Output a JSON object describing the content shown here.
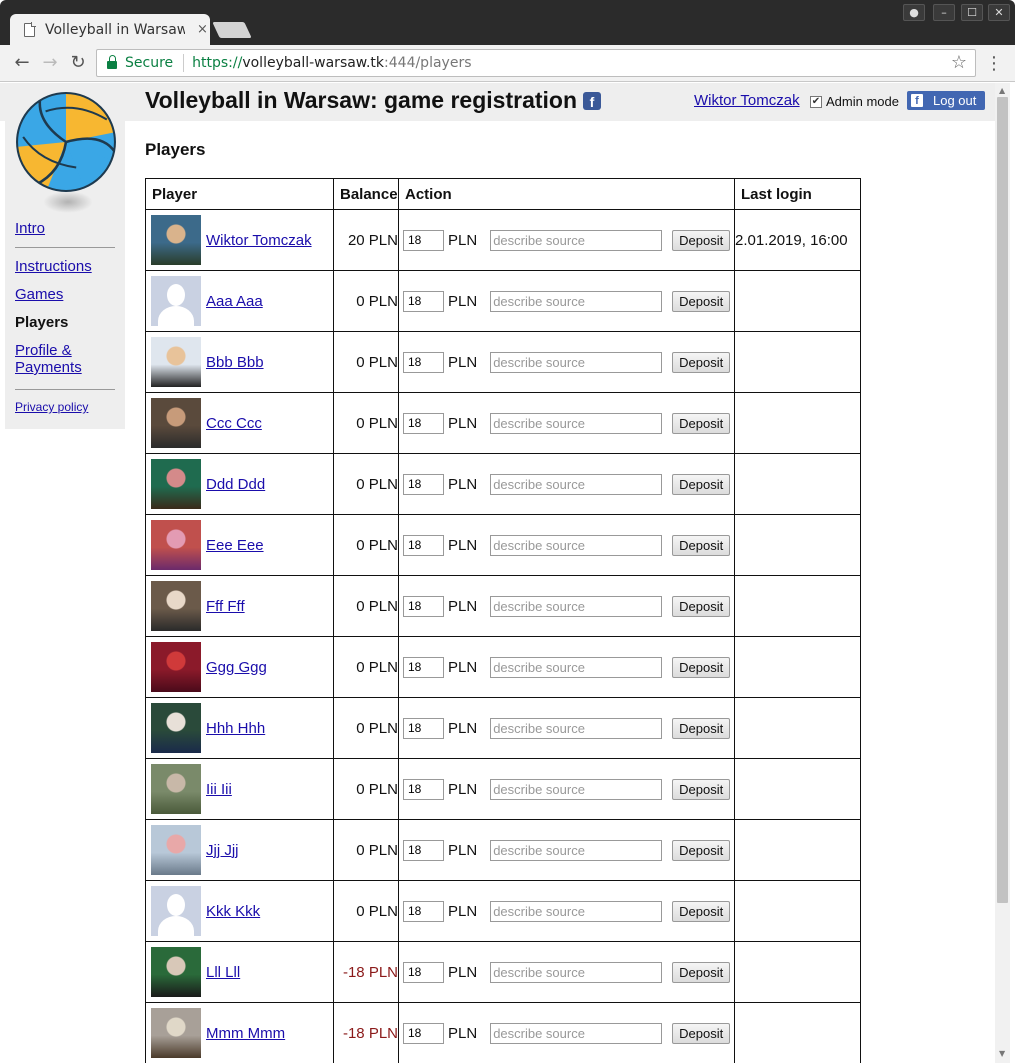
{
  "browser": {
    "tab_title": "Volleyball in Warsaw",
    "tab_close": "×",
    "secure_label": "Secure",
    "url_scheme": "https://",
    "url_host": "volleyball-warsaw.tk",
    "url_rest": ":444/players"
  },
  "header": {
    "title": "Volleyball in Warsaw: game registration",
    "facebook_glyph": "f",
    "user_name": "Wiktor Tomczak",
    "admin_checked": true,
    "admin_label": "Admin mode",
    "logout_label": "Log out"
  },
  "sidebar": {
    "items": [
      {
        "label": "Intro",
        "current": false
      },
      {
        "label": "Instructions",
        "current": false
      },
      {
        "label": "Games",
        "current": false
      },
      {
        "label": "Players",
        "current": true
      },
      {
        "label": "Profile & Payments",
        "current": false
      },
      {
        "label": "Privacy policy",
        "current": false
      }
    ]
  },
  "section_title": "Players",
  "table": {
    "headers": [
      "Player",
      "Balance",
      "Action",
      "Last login"
    ],
    "amount_default": "18",
    "currency": "PLN",
    "source_placeholder": "describe source",
    "deposit_label": "Deposit",
    "rows": [
      {
        "name": "Wiktor Tomczak",
        "balance": "20 PLN",
        "negative": false,
        "last_login": "2.01.2019, 16:00",
        "avatar": "photo"
      },
      {
        "name": "Aaa Aaa",
        "balance": "0 PLN",
        "negative": false,
        "last_login": "",
        "avatar": "default"
      },
      {
        "name": "Bbb Bbb",
        "balance": "0 PLN",
        "negative": false,
        "last_login": "",
        "avatar": "photo"
      },
      {
        "name": "Ccc Ccc",
        "balance": "0 PLN",
        "negative": false,
        "last_login": "",
        "avatar": "photo"
      },
      {
        "name": "Ddd Ddd",
        "balance": "0 PLN",
        "negative": false,
        "last_login": "",
        "avatar": "photo"
      },
      {
        "name": "Eee Eee",
        "balance": "0 PLN",
        "negative": false,
        "last_login": "",
        "avatar": "photo"
      },
      {
        "name": "Fff Fff",
        "balance": "0 PLN",
        "negative": false,
        "last_login": "",
        "avatar": "photo"
      },
      {
        "name": "Ggg Ggg",
        "balance": "0 PLN",
        "negative": false,
        "last_login": "",
        "avatar": "photo"
      },
      {
        "name": "Hhh Hhh",
        "balance": "0 PLN",
        "negative": false,
        "last_login": "",
        "avatar": "photo"
      },
      {
        "name": "Iii Iii",
        "balance": "0 PLN",
        "negative": false,
        "last_login": "",
        "avatar": "photo"
      },
      {
        "name": "Jjj Jjj",
        "balance": "0 PLN",
        "negative": false,
        "last_login": "",
        "avatar": "photo"
      },
      {
        "name": "Kkk Kkk",
        "balance": "0 PLN",
        "negative": false,
        "last_login": "",
        "avatar": "default"
      },
      {
        "name": "Lll Lll",
        "balance": "-18 PLN",
        "negative": true,
        "last_login": "",
        "avatar": "photo"
      },
      {
        "name": "Mmm Mmm",
        "balance": "-18 PLN",
        "negative": true,
        "last_login": "",
        "avatar": "photo"
      }
    ]
  },
  "colors": {
    "link": "#1a0dab",
    "negative_balance": "#8b1a1a",
    "secure_green": "#0b8043",
    "facebook_blue": "#4267b2",
    "ball_yellow": "#f7b731",
    "ball_blue": "#3aa7e6"
  },
  "icons": {
    "back": "←",
    "forward": "→",
    "reload": "↻",
    "star": "☆",
    "menu": "⋮",
    "win_minimize": "–",
    "win_maximize": "☐",
    "win_close": "✕",
    "profile": "●",
    "check": "✔"
  }
}
